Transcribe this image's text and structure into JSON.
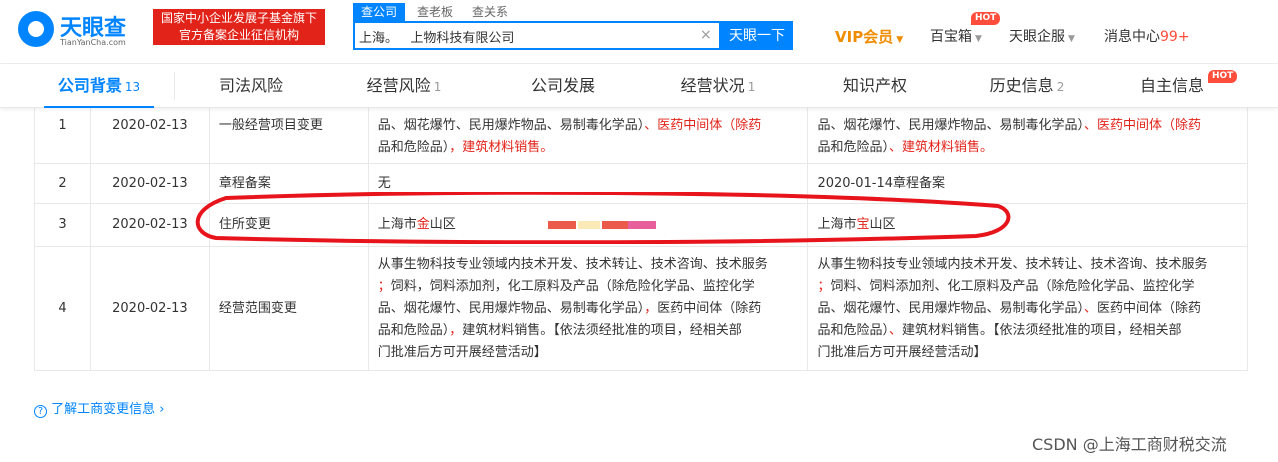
{
  "header": {
    "logo_name": "天眼查",
    "logo_domain": "TianYanCha.com",
    "badge_line1": "国家中小企业发展子基金旗下",
    "badge_line2": "官方备案企业征信机构",
    "search_tabs": [
      "查公司",
      "查老板",
      "查关系"
    ],
    "search_value": "上海。   上物科技有限公司",
    "search_button": "天眼一下",
    "vip_label": "VIP会员",
    "nav": [
      {
        "label": "百宝箱",
        "hot": "HOT"
      },
      {
        "label": "天眼企服"
      },
      {
        "label": "消息中心",
        "count": "99+"
      }
    ]
  },
  "tabs": [
    {
      "label": "公司背景",
      "count": "13",
      "active": true
    },
    {
      "label": "司法风险",
      "count": ""
    },
    {
      "label": "经营风险",
      "count": "1"
    },
    {
      "label": "公司发展",
      "count": ""
    },
    {
      "label": "经营状况",
      "count": "1"
    },
    {
      "label": "知识产权",
      "count": ""
    },
    {
      "label": "历史信息",
      "count": "2"
    },
    {
      "label": "自主信息",
      "count": "",
      "hot": "HOT"
    }
  ],
  "rows": [
    {
      "idx": "1",
      "date": "2020-02-13",
      "item": "一般经营项目变更",
      "before": [
        "品、烟花爆竹、民用爆炸物品、易制毒化学品）",
        "、医药中间体（除药",
        "品和危险品）",
        "，建筑材料销售。"
      ],
      "after": [
        "品、烟花爆竹、民用爆炸物品、易制毒化学品）",
        "、医药中间体（除药",
        "品和危险品）",
        "、建筑材料销售。"
      ]
    },
    {
      "idx": "2",
      "date": "2020-02-13",
      "item": "章程备案",
      "before": "无",
      "after": "2020-01-14章程备案"
    },
    {
      "idx": "3",
      "date": "2020-02-13",
      "item": "住所变更",
      "before_prefix": "上海市",
      "before_hl": "金",
      "before_suffix": "山区",
      "after_prefix": "上海市",
      "after_hl": "宝",
      "after_suffix": "山区"
    },
    {
      "idx": "4",
      "date": "2020-02-13",
      "item": "经营范围变更",
      "before": [
        "从事生物科技专业领域内技术开发、技术转让、技术咨询、技术服务",
        "；",
        "饲料，饲料添加剂，化工原料及产品（除危险化学品、监控化学",
        "品、烟花爆竹、民用爆炸物品、易制毒化学品）",
        "，",
        "医药中间体（除药",
        "品和危险品）",
        "，",
        "建筑材料销售。【依法须经批准的项目，经相关部",
        "门批准后方可开展经营活动】"
      ],
      "after": [
        "从事生物科技专业领域内技术开发、技术转让、技术咨询、技术服务",
        "；",
        "饲料、饲料添加剂、化工原料及产品（除危险化学品、监控化学",
        "品、烟花爆竹、民用爆炸物品、易制毒化学品）",
        "、",
        "医药中间体（除药",
        "品和危险品）",
        "、",
        "建筑材料销售。【依法须经批准的项目，经相关部",
        "门批准后方可开展经营活动】"
      ]
    }
  ],
  "help_link": "了解工商变更信息",
  "watermark": "CSDN @上海工商财税交流",
  "colors": {
    "brand": "#0084ff",
    "highlight_red": "#e2231a",
    "vip": "#f08c00",
    "annotation": "#e8141c"
  },
  "icons": {
    "help": "question-circle-icon",
    "chevron": "chevron-right-icon",
    "clear": "close-icon"
  }
}
